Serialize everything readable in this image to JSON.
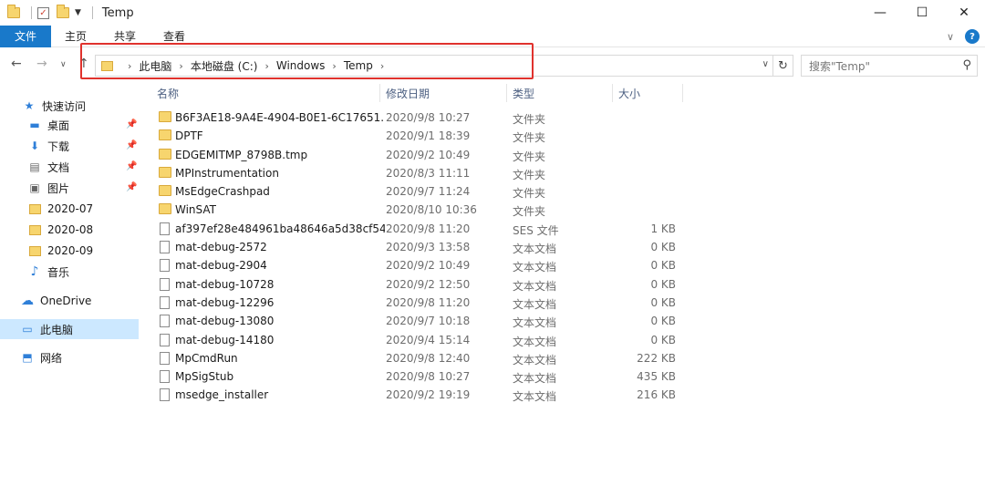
{
  "window": {
    "title": "Temp",
    "minimize_glyph": "—",
    "maximize_glyph": "☐",
    "close_glyph": "✕"
  },
  "ribbon": {
    "tabs": [
      "文件",
      "主页",
      "共享",
      "查看"
    ]
  },
  "address": {
    "crumbs": [
      "此电脑",
      "本地磁盘 (C:)",
      "Windows",
      "Temp"
    ]
  },
  "search": {
    "placeholder": "搜索\"Temp\""
  },
  "highlight_color": "#e0322d",
  "sidebar": {
    "quick_access": "快速访问",
    "items": [
      {
        "label": "桌面",
        "icon": "desktop-icon",
        "pinned": true
      },
      {
        "label": "下载",
        "icon": "download-icon",
        "pinned": true
      },
      {
        "label": "文档",
        "icon": "document-icon",
        "pinned": true
      },
      {
        "label": "图片",
        "icon": "picture-icon",
        "pinned": true
      },
      {
        "label": "2020-07",
        "icon": "folder-icon",
        "pinned": false
      },
      {
        "label": "2020-08",
        "icon": "folder-icon",
        "pinned": false
      },
      {
        "label": "2020-09",
        "icon": "folder-icon",
        "pinned": false
      },
      {
        "label": "音乐",
        "icon": "music-icon",
        "pinned": false
      }
    ],
    "onedrive": "OneDrive",
    "this_pc": "此电脑",
    "network": "网络"
  },
  "columns": {
    "name": "名称",
    "date": "修改日期",
    "type": "类型",
    "size": "大小"
  },
  "files": [
    {
      "name": "B6F3AE18-9A4E-4904-B0E1-6C17651...",
      "date": "2020/9/8 10:27",
      "type": "文件夹",
      "size": "",
      "kind": "folder"
    },
    {
      "name": "DPTF",
      "date": "2020/9/1 18:39",
      "type": "文件夹",
      "size": "",
      "kind": "folder"
    },
    {
      "name": "EDGEMITMP_8798B.tmp",
      "date": "2020/9/2 10:49",
      "type": "文件夹",
      "size": "",
      "kind": "folder"
    },
    {
      "name": "MPInstrumentation",
      "date": "2020/8/3 11:11",
      "type": "文件夹",
      "size": "",
      "kind": "folder"
    },
    {
      "name": "MsEdgeCrashpad",
      "date": "2020/9/7 11:24",
      "type": "文件夹",
      "size": "",
      "kind": "folder"
    },
    {
      "name": "WinSAT",
      "date": "2020/8/10 10:36",
      "type": "文件夹",
      "size": "",
      "kind": "folder"
    },
    {
      "name": "af397ef28e484961ba48646a5d38cf54...",
      "date": "2020/9/8 11:20",
      "type": "SES 文件",
      "size": "1 KB",
      "kind": "file"
    },
    {
      "name": "mat-debug-2572",
      "date": "2020/9/3 13:58",
      "type": "文本文档",
      "size": "0 KB",
      "kind": "file"
    },
    {
      "name": "mat-debug-2904",
      "date": "2020/9/2 10:49",
      "type": "文本文档",
      "size": "0 KB",
      "kind": "file"
    },
    {
      "name": "mat-debug-10728",
      "date": "2020/9/2 12:50",
      "type": "文本文档",
      "size": "0 KB",
      "kind": "file"
    },
    {
      "name": "mat-debug-12296",
      "date": "2020/9/8 11:20",
      "type": "文本文档",
      "size": "0 KB",
      "kind": "file"
    },
    {
      "name": "mat-debug-13080",
      "date": "2020/9/7 10:18",
      "type": "文本文档",
      "size": "0 KB",
      "kind": "file"
    },
    {
      "name": "mat-debug-14180",
      "date": "2020/9/4 15:14",
      "type": "文本文档",
      "size": "0 KB",
      "kind": "file"
    },
    {
      "name": "MpCmdRun",
      "date": "2020/9/8 12:40",
      "type": "文本文档",
      "size": "222 KB",
      "kind": "file"
    },
    {
      "name": "MpSigStub",
      "date": "2020/9/8 10:27",
      "type": "文本文档",
      "size": "435 KB",
      "kind": "file"
    },
    {
      "name": "msedge_installer",
      "date": "2020/9/2 19:19",
      "type": "文本文档",
      "size": "216 KB",
      "kind": "file"
    }
  ]
}
